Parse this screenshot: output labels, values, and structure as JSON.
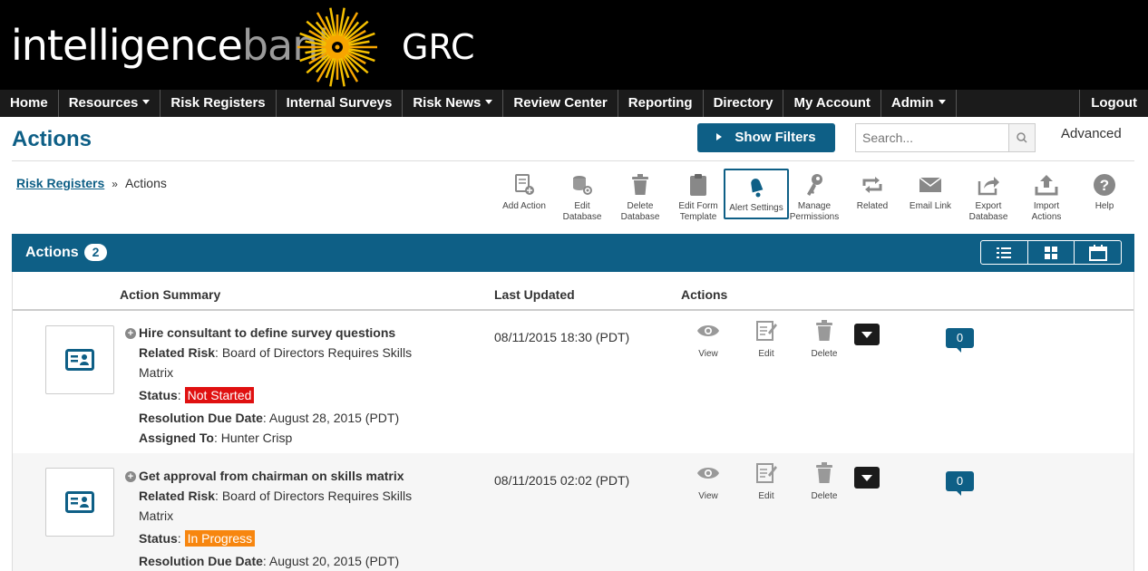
{
  "brand": {
    "name_a": "intelligence",
    "name_b": "bank",
    "product": "GRC"
  },
  "nav": {
    "items": [
      {
        "label": "Home",
        "dropdown": false
      },
      {
        "label": "Resources",
        "dropdown": true
      },
      {
        "label": "Risk Registers",
        "dropdown": false
      },
      {
        "label": "Internal Surveys",
        "dropdown": false
      },
      {
        "label": "Risk News",
        "dropdown": true
      },
      {
        "label": "Review Center",
        "dropdown": false
      },
      {
        "label": "Reporting",
        "dropdown": false
      },
      {
        "label": "Directory",
        "dropdown": false
      },
      {
        "label": "My Account",
        "dropdown": false
      },
      {
        "label": "Admin",
        "dropdown": true
      }
    ],
    "logout": "Logout"
  },
  "page": {
    "title": "Actions",
    "show_filters": "Show Filters",
    "search_placeholder": "Search...",
    "advanced": "Advanced"
  },
  "breadcrumb": {
    "parent": "Risk Registers",
    "separator": "»",
    "current": "Actions"
  },
  "toolbar": [
    {
      "id": "add-action",
      "l1": "Add Action",
      "l2": "",
      "icon": "add-document-icon"
    },
    {
      "id": "edit-database",
      "l1": "Edit",
      "l2": "Database",
      "icon": "database-gear-icon"
    },
    {
      "id": "delete-database",
      "l1": "Delete",
      "l2": "Database",
      "icon": "trash-icon"
    },
    {
      "id": "edit-form-template",
      "l1": "Edit Form",
      "l2": "Template",
      "icon": "clipboard-icon"
    },
    {
      "id": "alert-settings",
      "l1": "Alert Settings",
      "l2": "",
      "icon": "bell-icon"
    },
    {
      "id": "manage-permissions",
      "l1": "Manage",
      "l2": "Permissions",
      "icon": "key-icon"
    },
    {
      "id": "related",
      "l1": "Related",
      "l2": "",
      "icon": "related-arrows-icon"
    },
    {
      "id": "email-link",
      "l1": "Email Link",
      "l2": "",
      "icon": "envelope-icon"
    },
    {
      "id": "export-database",
      "l1": "Export",
      "l2": "Database",
      "icon": "share-icon"
    },
    {
      "id": "import-actions",
      "l1": "Import",
      "l2": "Actions",
      "icon": "upload-icon"
    },
    {
      "id": "help",
      "l1": "Help",
      "l2": "",
      "icon": "help-icon"
    }
  ],
  "panel": {
    "title": "Actions",
    "count": "2",
    "columns": {
      "summary": "Action Summary",
      "updated": "Last Updated",
      "actions": "Actions"
    }
  },
  "labels": {
    "related_risk": "Related Risk",
    "status": "Status",
    "due": "Resolution Due Date",
    "assigned": "Assigned To",
    "view": "View",
    "edit": "Edit",
    "delete": "Delete"
  },
  "rows": [
    {
      "title": "Hire consultant to define survey questions",
      "related_risk": "Board of Directors Requires Skills Matrix",
      "status": "Not Started",
      "due": "August 28, 2015 (PDT)",
      "assigned": "Hunter Crisp",
      "updated": "08/11/2015 18:30 (PDT)",
      "comments": "0"
    },
    {
      "title": "Get approval from chairman on skills matrix",
      "related_risk": "Board of Directors Requires Skills Matrix",
      "status": "In Progress",
      "due": "August 20, 2015 (PDT)",
      "updated": "08/11/2015 02:02 (PDT)",
      "comments": "0"
    }
  ],
  "colors": {
    "brand_blue": "#0e5f86",
    "status_not_started": "#e01010",
    "status_in_progress": "#f7860f"
  }
}
